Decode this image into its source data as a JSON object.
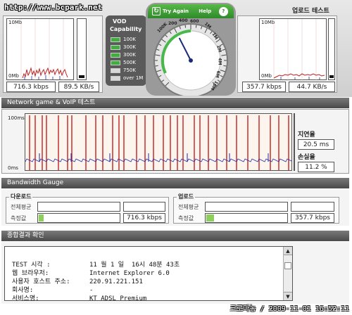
{
  "watermark_url": "http://www.bcpark.net",
  "upload_title": "업로드 테스트",
  "download_graph": {
    "scale_top": "10Mb",
    "scale_bottom": "0Mb",
    "kbps": "716.3 kbps",
    "kbs": "89.5 KB/s"
  },
  "upload_graph": {
    "scale_top": "10Mb",
    "scale_bottom": "0Mb",
    "kbps": "357.7 kbps",
    "kbs": "44.7 KB/s"
  },
  "vod": {
    "title_line1": "VOD",
    "title_line2": "Capability",
    "items": [
      {
        "label": "100K",
        "color": "#3fae3f"
      },
      {
        "label": "300K",
        "color": "#3fae3f"
      },
      {
        "label": "300K",
        "color": "#3fae3f"
      },
      {
        "label": "500K",
        "color": "#3fae3f"
      },
      {
        "label": "750K",
        "color": "#d8d8d8"
      },
      {
        "label": "over 1M",
        "color": "#d8d8d8"
      }
    ]
  },
  "gauge": {
    "try_again": "Try Again",
    "help": "Help",
    "help_icon": "?",
    "ticks": [
      "100K",
      "200",
      "400",
      "600",
      "1M",
      "1M",
      "2M",
      "4M",
      "6M",
      "10M"
    ],
    "needle_fraction": 0.4
  },
  "network_section": "Network game & VoIP 테스트",
  "ping": {
    "scale_top": "100ms",
    "scale_bottom": "0ms",
    "latency_label": "지연율",
    "latency_value": "20.5 ms",
    "loss_label": "손실율",
    "loss_value": "11.2 %"
  },
  "bandwidth_section": "Bandwidth Gauge",
  "bw_download": {
    "title": "다운로드",
    "avg_label": "전체평균",
    "measured_label": "측정값",
    "measured_value": "716.3 kbps",
    "fill_fraction": 0.06
  },
  "bw_upload": {
    "title": "업로드",
    "avg_label": "전체평균",
    "measured_label": "측정값",
    "measured_value": "357.7 kbps",
    "fill_fraction": 0.1
  },
  "result_section": "종합결과 확인",
  "results": [
    {
      "label": "TEST 시각 :",
      "value": "11 월 1 일  16시 48분 43초"
    },
    {
      "label": "웹 브라우저:",
      "value": "Internet Explorer 6.0"
    },
    {
      "label": "사용자 호스트 주소:",
      "value": "220.91.221.151"
    },
    {
      "label": "회사명:",
      "value": "-"
    },
    {
      "label": "서비스명:",
      "value": "KT ADSL Premium"
    }
  ],
  "caption": "크로마농 / 2009-11-01 16:52:11"
}
